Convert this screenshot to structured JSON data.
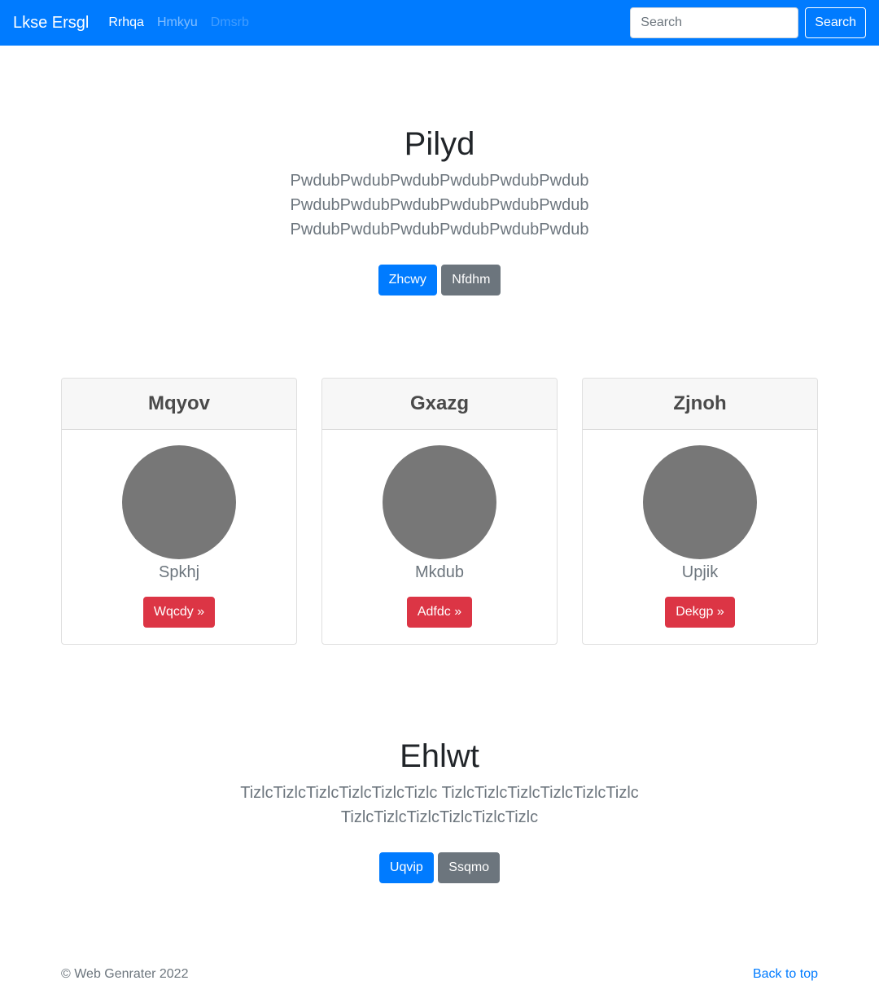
{
  "navbar": {
    "brand": "Lkse Ersgl",
    "links": [
      {
        "label": "Rrhqa",
        "state": "active"
      },
      {
        "label": "Hmkyu",
        "state": "normal"
      },
      {
        "label": "Dmsrb",
        "state": "disabled"
      }
    ],
    "search_placeholder": "Search",
    "search_button": "Search"
  },
  "hero": {
    "title": "Pilyd",
    "lines": [
      "PwdubPwdubPwdubPwdubPwdubPwdub",
      "PwdubPwdubPwdubPwdubPwdubPwdub",
      "PwdubPwdubPwdubPwdubPwdubPwdub"
    ],
    "primary_button": "Zhcwy",
    "secondary_button": "Nfdhm"
  },
  "cards": [
    {
      "title": "Mqyov",
      "name": "Spkhj",
      "button": "Wqcdy »"
    },
    {
      "title": "Gxazg",
      "name": "Mkdub",
      "button": "Adfdc »"
    },
    {
      "title": "Zjnoh",
      "name": "Upjik",
      "button": "Dekgp »"
    }
  ],
  "section2": {
    "title": "Ehlwt",
    "lines": [
      "TizlcTizlcTizlcTizlcTizlcTizlc TizlcTizlcTizlcTizlcTizlcTizlc",
      "TizlcTizlcTizlcTizlcTizlcTizlc"
    ],
    "primary_button": "Uqvip",
    "secondary_button": "Ssqmo"
  },
  "footer": {
    "copyright": "© Web Genrater 2022",
    "back_to_top": "Back to top"
  },
  "colors": {
    "primary": "#007bff",
    "secondary": "#6c757d",
    "danger": "#dc3545",
    "avatar": "#777777"
  }
}
